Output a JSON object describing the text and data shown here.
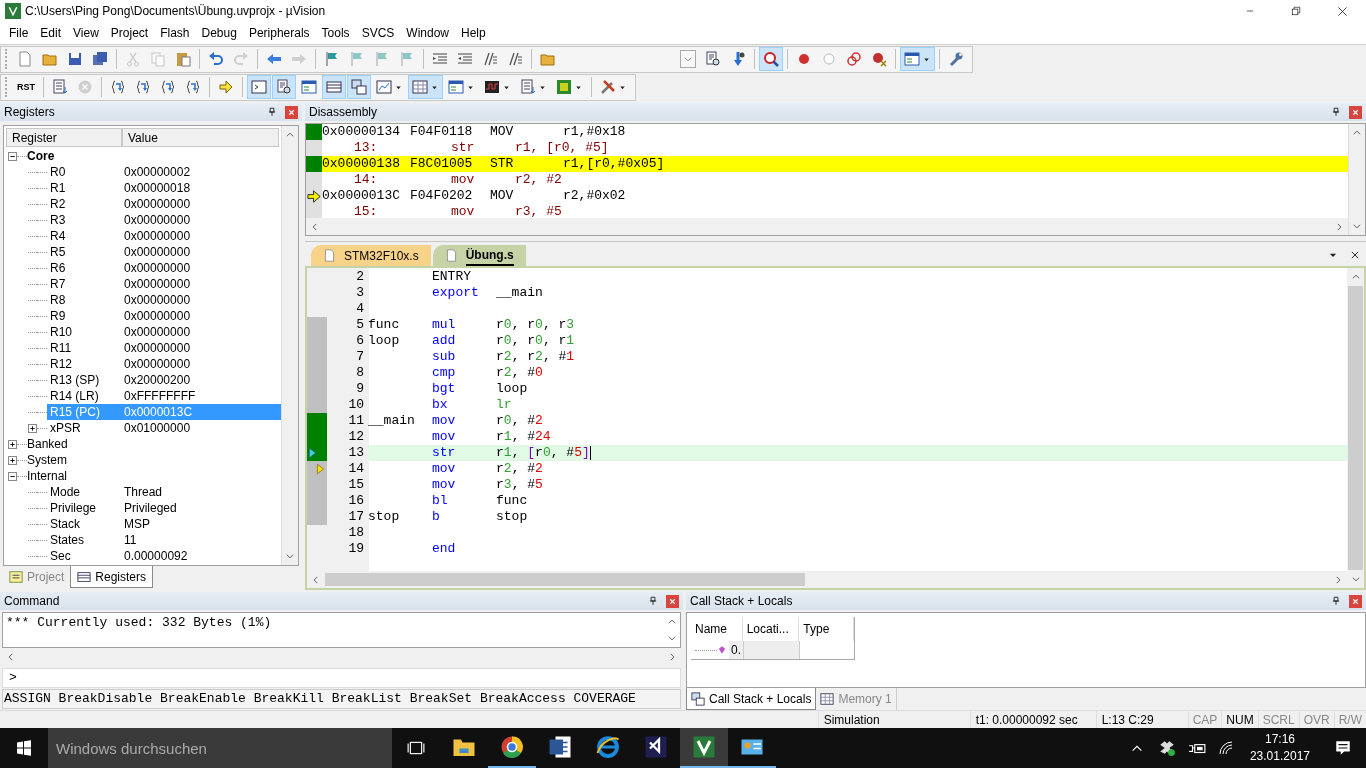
{
  "window": {
    "title": "C:\\Users\\Ping Pong\\Documents\\Übung.uvprojx - µVision"
  },
  "menu": [
    "File",
    "Edit",
    "View",
    "Project",
    "Flash",
    "Debug",
    "Peripherals",
    "Tools",
    "SVCS",
    "Window",
    "Help"
  ],
  "toolbar_1": [
    {
      "kind": "page",
      "pressed": false,
      "disabled": false
    },
    {
      "kind": "folder",
      "pressed": false,
      "disabled": false
    },
    {
      "kind": "disk",
      "pressed": false,
      "disabled": false
    },
    {
      "kind": "disks",
      "pressed": false,
      "disabled": false
    },
    {
      "kind": "separator"
    },
    {
      "kind": "scissors",
      "pressed": false,
      "disabled": true
    },
    {
      "kind": "copy",
      "pressed": false,
      "disabled": true
    },
    {
      "kind": "paste",
      "pressed": false,
      "disabled": false
    },
    {
      "kind": "separator"
    },
    {
      "kind": "undo",
      "pressed": false,
      "disabled": false
    },
    {
      "kind": "redo",
      "pressed": false,
      "disabled": true
    },
    {
      "kind": "separator"
    },
    {
      "kind": "left",
      "pressed": false,
      "disabled": false
    },
    {
      "kind": "right",
      "pressed": false,
      "disabled": true
    },
    {
      "kind": "separator"
    },
    {
      "kind": "flag",
      "pressed": false,
      "disabled": false
    },
    {
      "kind": "flag",
      "pressed": false,
      "disabled": true
    },
    {
      "kind": "flag",
      "pressed": false,
      "disabled": true
    },
    {
      "kind": "flag",
      "pressed": false,
      "disabled": true
    },
    {
      "kind": "separator"
    },
    {
      "kind": "indent",
      "pressed": false,
      "disabled": false
    },
    {
      "kind": "outdent",
      "pressed": false,
      "disabled": false
    },
    {
      "kind": "slashes",
      "pressed": false,
      "disabled": false
    },
    {
      "kind": "slashes",
      "pressed": false,
      "disabled": false
    },
    {
      "kind": "separator"
    },
    {
      "kind": "folder",
      "pressed": false,
      "disabled": false
    },
    {
      "kind": "spacer"
    },
    {
      "kind": "combo"
    },
    {
      "kind": "docsearch",
      "pressed": false,
      "disabled": false
    },
    {
      "kind": "binoculars",
      "pressed": false,
      "disabled": false
    },
    {
      "kind": "separator"
    },
    {
      "kind": "magnifier",
      "pressed": true,
      "disabled": false
    },
    {
      "kind": "separator"
    },
    {
      "kind": "dot",
      "pressed": false,
      "disabled": false
    },
    {
      "kind": "ring",
      "pressed": false,
      "disabled": false
    },
    {
      "kind": "rings",
      "pressed": false,
      "disabled": false
    },
    {
      "kind": "dotx",
      "pressed": false,
      "disabled": false
    },
    {
      "kind": "separator"
    },
    {
      "kind": "window",
      "pressed": true,
      "disabled": false,
      "dropdown": true
    },
    {
      "kind": "separator"
    },
    {
      "kind": "wrench",
      "pressed": false,
      "disabled": false
    }
  ],
  "toolbar_2": [
    {
      "kind": "rst",
      "label": "RST",
      "pressed": false,
      "disabled": false
    },
    {
      "kind": "separator"
    },
    {
      "kind": "list",
      "pressed": false,
      "disabled": false
    },
    {
      "kind": "stop",
      "pressed": false,
      "disabled": true
    },
    {
      "kind": "separator"
    },
    {
      "kind": "braces",
      "pressed": false,
      "disabled": false
    },
    {
      "kind": "braces",
      "pressed": false,
      "disabled": false
    },
    {
      "kind": "braces",
      "pressed": false,
      "disabled": false
    },
    {
      "kind": "braces",
      "pressed": false,
      "disabled": false
    },
    {
      "kind": "separator"
    },
    {
      "kind": "arrow",
      "pressed": false,
      "disabled": false
    },
    {
      "kind": "separator"
    },
    {
      "kind": "console",
      "pressed": true,
      "disabled": false
    },
    {
      "kind": "docsearch",
      "pressed": true,
      "disabled": false
    },
    {
      "kind": "window",
      "pressed": false,
      "disabled": false
    },
    {
      "kind": "lines",
      "pressed": true,
      "disabled": false
    },
    {
      "kind": "windows",
      "pressed": true,
      "disabled": false
    },
    {
      "kind": "chart",
      "pressed": false,
      "disabled": false,
      "dropdown": true
    },
    {
      "kind": "grid",
      "pressed": true,
      "disabled": false,
      "dropdown": true
    },
    {
      "kind": "window",
      "pressed": false,
      "disabled": false,
      "dropdown": true
    },
    {
      "kind": "wave",
      "pressed": false,
      "disabled": false,
      "dropdown": true
    },
    {
      "kind": "list",
      "pressed": false,
      "disabled": false,
      "dropdown": true
    },
    {
      "kind": "chip",
      "pressed": false,
      "disabled": false,
      "dropdown": true
    },
    {
      "kind": "separator"
    },
    {
      "kind": "tools",
      "pressed": false,
      "disabled": false,
      "dropdown": true
    }
  ],
  "registers": {
    "title": "Registers",
    "columns": [
      "Register",
      "Value"
    ],
    "tree": [
      {
        "name": "Core",
        "bold": true,
        "expanded": true,
        "children": [
          {
            "name": "R0",
            "value": "0x00000002",
            "selected": false
          },
          {
            "name": "R1",
            "value": "0x00000018",
            "selected": false
          },
          {
            "name": "R2",
            "value": "0x00000000",
            "selected": false
          },
          {
            "name": "R3",
            "value": "0x00000000",
            "selected": false
          },
          {
            "name": "R4",
            "value": "0x00000000",
            "selected": false
          },
          {
            "name": "R5",
            "value": "0x00000000",
            "selected": false
          },
          {
            "name": "R6",
            "value": "0x00000000",
            "selected": false
          },
          {
            "name": "R7",
            "value": "0x00000000",
            "selected": false
          },
          {
            "name": "R8",
            "value": "0x00000000",
            "selected": false
          },
          {
            "name": "R9",
            "value": "0x00000000",
            "selected": false
          },
          {
            "name": "R10",
            "value": "0x00000000",
            "selected": false
          },
          {
            "name": "R11",
            "value": "0x00000000",
            "selected": false
          },
          {
            "name": "R12",
            "value": "0x00000000",
            "selected": false
          },
          {
            "name": "R13 (SP)",
            "value": "0x20000200",
            "selected": false
          },
          {
            "name": "R14 (LR)",
            "value": "0xFFFFFFFF",
            "selected": false
          },
          {
            "name": "R15 (PC)",
            "value": "0x0000013C",
            "selected": true
          },
          {
            "name": "xPSR",
            "value": "0x01000000",
            "selected": false,
            "expanded": false
          }
        ]
      },
      {
        "name": "Banked",
        "bold": false,
        "expanded": false
      },
      {
        "name": "System",
        "bold": false,
        "expanded": false
      },
      {
        "name": "Internal",
        "bold": false,
        "expanded": true,
        "children": [
          {
            "name": "Mode",
            "value": "Thread",
            "selected": false
          },
          {
            "name": "Privilege",
            "value": "Privileged",
            "selected": false
          },
          {
            "name": "Stack",
            "value": "MSP",
            "selected": false
          },
          {
            "name": "States",
            "value": "11",
            "selected": false
          },
          {
            "name": "Sec",
            "value": "0.00000092",
            "selected": false
          }
        ]
      }
    ],
    "tabs": [
      {
        "label": "Project",
        "kind": "project",
        "selected": false
      },
      {
        "label": "Registers",
        "kind": "registers",
        "selected": true
      }
    ]
  },
  "disassembly": {
    "title": "Disassembly",
    "lines": [
      {
        "kind": "asm",
        "address": "0x00000134",
        "opcode": "F04F0118",
        "mnemonic": "MOV",
        "operands": "r1,#0x18",
        "executed": true,
        "current": false,
        "pc": false
      },
      {
        "kind": "source",
        "line": "13:",
        "mnemonic": "str",
        "operands": "r1, [r0, #5]"
      },
      {
        "kind": "asm",
        "address": "0x00000138",
        "opcode": "F8C01005",
        "mnemonic": "STR",
        "operands": "r1,[r0,#0x05]",
        "executed": true,
        "current": true,
        "pc": false
      },
      {
        "kind": "source",
        "line": "14:",
        "mnemonic": "mov",
        "operands": "r2, #2"
      },
      {
        "kind": "asm",
        "address": "0x0000013C",
        "opcode": "F04F0202",
        "mnemonic": "MOV",
        "operands": "r2,#0x02",
        "executed": false,
        "current": false,
        "pc": true
      },
      {
        "kind": "source",
        "line": "15:",
        "mnemonic": "mov",
        "operands": "r3, #5"
      }
    ]
  },
  "editor": {
    "tabs": [
      {
        "label": "STM32F10x.s",
        "selected": false
      },
      {
        "label": "Übung.s",
        "selected": true
      }
    ],
    "lines": [
      {
        "number": "2",
        "mnemonic": "ENTRY",
        "kind": "directive",
        "current": false,
        "pc": false
      },
      {
        "number": "3",
        "mnemonic": "export",
        "kind": "instruction",
        "operands": "__main",
        "current": false,
        "pc": false
      },
      {
        "number": "4",
        "current": false,
        "pc": false
      },
      {
        "number": "5",
        "label": "func",
        "mnemonic": "mul",
        "kind": "instruction",
        "operands": "r0, r0, r3",
        "executed": false,
        "current": false,
        "pc": false
      },
      {
        "number": "6",
        "label": "loop",
        "mnemonic": "add",
        "kind": "instruction",
        "operands": "r0, r0, r1",
        "executed": false,
        "current": false,
        "pc": false
      },
      {
        "number": "7",
        "mnemonic": "sub",
        "kind": "instruction",
        "operands": "r2, r2, #1",
        "executed": false,
        "current": false,
        "pc": false
      },
      {
        "number": "8",
        "mnemonic": "cmp",
        "kind": "instruction",
        "operands": "r2, #0",
        "executed": false,
        "current": false,
        "pc": false
      },
      {
        "number": "9",
        "mnemonic": "bgt",
        "kind": "instruction",
        "operands": "loop",
        "executed": false,
        "current": false,
        "pc": false
      },
      {
        "number": "10",
        "mnemonic": "bx",
        "kind": "instruction",
        "operands": "lr",
        "executed": false,
        "current": false,
        "pc": false
      },
      {
        "number": "11",
        "label": "__main",
        "mnemonic": "mov",
        "kind": "instruction",
        "operands": "r0, #2",
        "executed": true,
        "current": false,
        "pc": false
      },
      {
        "number": "12",
        "mnemonic": "mov",
        "kind": "instruction",
        "operands": "r1, #24",
        "executed": true,
        "current": false,
        "pc": false
      },
      {
        "number": "13",
        "mnemonic": "str",
        "kind": "instruction",
        "operands": "r1, [r0, #5]",
        "executed": true,
        "current": true,
        "pc": false
      },
      {
        "number": "14",
        "mnemonic": "mov",
        "kind": "instruction",
        "operands": "r2, #2",
        "executed": false,
        "current": false,
        "pc": true
      },
      {
        "number": "15",
        "mnemonic": "mov",
        "kind": "instruction",
        "operands": "r3, #5",
        "executed": false,
        "current": false,
        "pc": false
      },
      {
        "number": "16",
        "mnemonic": "bl",
        "kind": "instruction",
        "operands": "func",
        "executed": false,
        "current": false,
        "pc": false
      },
      {
        "number": "17",
        "label": "stop",
        "mnemonic": "b",
        "kind": "instruction",
        "operands": "stop",
        "executed": false,
        "current": false,
        "pc": false
      },
      {
        "number": "18",
        "current": false,
        "pc": false
      },
      {
        "number": "19",
        "mnemonic": "end",
        "kind": "instruction",
        "current": false,
        "pc": false
      }
    ]
  },
  "command": {
    "title": "Command",
    "output": "*** Currently used: 332 Bytes (1%)",
    "prompt": ">",
    "hint": "ASSIGN BreakDisable BreakEnable BreakKill BreakList BreakSet BreakAccess COVERAGE"
  },
  "call_stack": {
    "title": "Call Stack + Locals",
    "columns": [
      "Name",
      "Locati...",
      "Type"
    ],
    "rows": [
      {
        "name": "0."
      }
    ],
    "tabs": [
      {
        "label": "Call Stack + Locals",
        "kind": "callstack",
        "selected": true
      },
      {
        "label": "Memory 1",
        "kind": "memory",
        "selected": false
      }
    ]
  },
  "status_bar": {
    "mode": "Simulation",
    "time": "t1: 0.00000092 sec",
    "position": "L:13 C:29",
    "indicators": [
      {
        "label": "CAP",
        "on": false
      },
      {
        "label": "NUM",
        "on": true
      },
      {
        "label": "SCRL",
        "on": false
      },
      {
        "label": "OVR",
        "on": false
      },
      {
        "label": "R/W",
        "on": false
      }
    ]
  },
  "taskbar": {
    "search_placeholder": "Windows durchsuchen",
    "apps": [
      {
        "kind": "folder",
        "running": false,
        "active": false
      },
      {
        "kind": "ring",
        "running": true,
        "active": false
      },
      {
        "kind": "doc",
        "running": false,
        "active": false
      },
      {
        "kind": "globe",
        "running": false,
        "active": false
      },
      {
        "kind": "ribbon",
        "running": false,
        "active": false
      },
      {
        "kind": "tile",
        "running": true,
        "active": true
      },
      {
        "kind": "card",
        "running": true,
        "active": false
      }
    ],
    "time": "17:16",
    "date": "23.01.2017"
  }
}
